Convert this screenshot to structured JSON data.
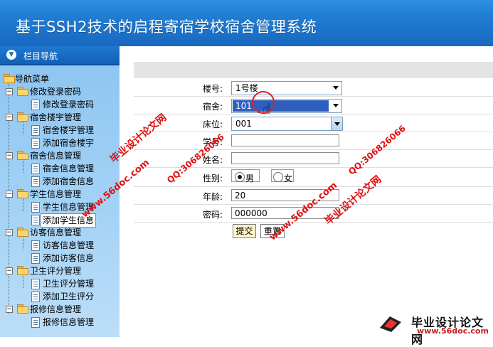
{
  "header": {
    "title": "基于SSH2技术的启程寄宿学校宿舍管理系统"
  },
  "sidebar": {
    "nav_title": "栏目导航",
    "root_label": "导航菜单",
    "groups": [
      {
        "label": "修改登录密码",
        "items": [
          "修改登录密码"
        ]
      },
      {
        "label": "宿舍楼宇管理",
        "items": [
          "宿舍楼宇管理",
          "添加宿舍楼宇"
        ]
      },
      {
        "label": "宿舍信息管理",
        "items": [
          "宿舍信息管理",
          "添加宿舍信息"
        ]
      },
      {
        "label": "学生信息管理",
        "items": [
          "学生信息管理",
          "添加学生信息"
        ]
      },
      {
        "label": "访客信息管理",
        "items": [
          "访客信息管理",
          "添加访客信息"
        ]
      },
      {
        "label": "卫生评分管理",
        "items": [
          "卫生评分管理",
          "添加卫生评分"
        ]
      },
      {
        "label": "报修信息管理",
        "items": [
          "报修信息管理"
        ]
      }
    ],
    "selected_item": "添加学生信息"
  },
  "form": {
    "building": {
      "label": "楼号:",
      "value": "1号楼"
    },
    "dorm": {
      "label": "宿舍:",
      "value": "101"
    },
    "bed": {
      "label": "床位:",
      "value": "001"
    },
    "student_no": {
      "label": "学号:",
      "value": ""
    },
    "name": {
      "label": "姓名:",
      "value": ""
    },
    "gender": {
      "label": "性别:",
      "options": [
        "男",
        "女"
      ],
      "selected": "男"
    },
    "age": {
      "label": "年龄:",
      "value": "20"
    },
    "password": {
      "label": "密码:",
      "value": "000000"
    },
    "submit_label": "提交",
    "reset_label": "重置"
  },
  "watermarks": {
    "site_cn": "毕业设计论文网",
    "site_url": "www.56doc.com",
    "qq": "QQ:306826066"
  },
  "footer_logo": {
    "name": "毕业设计论文网",
    "url": "www.56doc.com"
  },
  "colors": {
    "header": "#1f7bd1",
    "nav_body": "#a7d4f6",
    "watermark_red": "#e01010"
  }
}
